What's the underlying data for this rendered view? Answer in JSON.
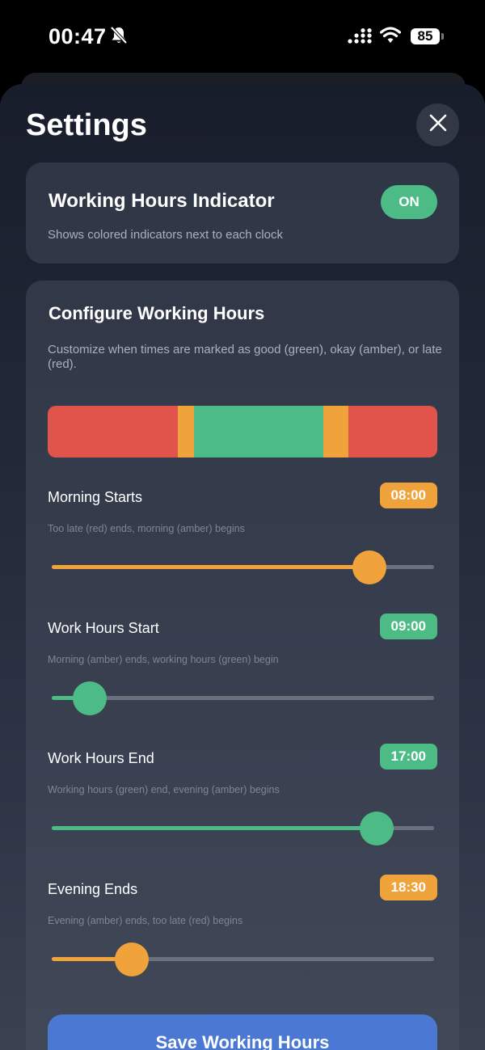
{
  "status_bar": {
    "time": "00:47",
    "battery": "85",
    "icons": [
      "bell-slash-icon",
      "signal-icon",
      "wifi-icon",
      "battery-icon"
    ]
  },
  "sheet": {
    "title": "Settings",
    "close_icon": "close-icon"
  },
  "indicator_card": {
    "title": "Working Hours Indicator",
    "description": "Shows colored indicators next to each clock",
    "toggle_label": "ON",
    "toggle_on": true
  },
  "config_card": {
    "title": "Configure Working Hours",
    "description": "Customize when times are marked as good (green), okay (amber), or late (red).",
    "timeline": [
      {
        "color": "red",
        "hours": 8
      },
      {
        "color": "amber",
        "hours": 1
      },
      {
        "color": "green",
        "hours": 8
      },
      {
        "color": "amber",
        "hours": 1.5
      },
      {
        "color": "red",
        "hours": 5.5
      }
    ],
    "settings": [
      {
        "label": "Morning Starts",
        "value": "08:00",
        "help": "Too late (red) ends, morning (amber) begins",
        "color": "amber",
        "level": 0.83
      },
      {
        "label": "Work Hours Start",
        "value": "09:00",
        "help": "Morning (amber) ends, working hours (green) begin",
        "color": "green",
        "level": 0.1
      },
      {
        "label": "Work Hours End",
        "value": "17:00",
        "help": "Working hours (green) end, evening (amber) begins",
        "color": "green",
        "level": 0.85
      },
      {
        "label": "Evening Ends",
        "value": "18:30",
        "help": "Evening (amber) ends, too late (red) begins",
        "color": "amber",
        "level": 0.21
      }
    ],
    "save_label": "Save Working Hours"
  },
  "colors": {
    "red": "#e0544b",
    "amber": "#f0a33b",
    "green": "#4cbb86",
    "blue": "#4a78d3"
  }
}
